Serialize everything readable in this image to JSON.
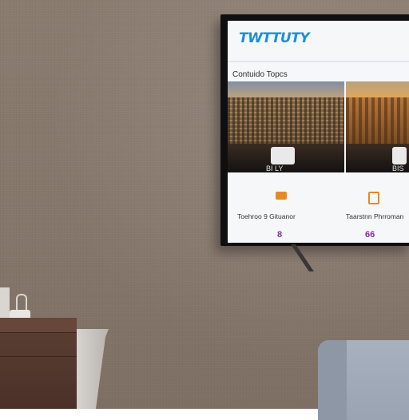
{
  "tv": {
    "brand_text": "TWTTUTY",
    "section_title": "Contuido Topcs",
    "thumbnails": [
      {
        "caption": "BI LY"
      },
      {
        "caption": "BIS"
      }
    ],
    "apps": [
      {
        "label": "Toehroo 9 Gituanor",
        "glyph": "8"
      },
      {
        "label": "Taarstnn Phrroman",
        "glyph": "66"
      }
    ]
  },
  "colors": {
    "brand": "#1c8fd6",
    "accent_orange": "#e78a25",
    "glyph_purple": "#8a2c9b",
    "wall": "#85766a"
  }
}
